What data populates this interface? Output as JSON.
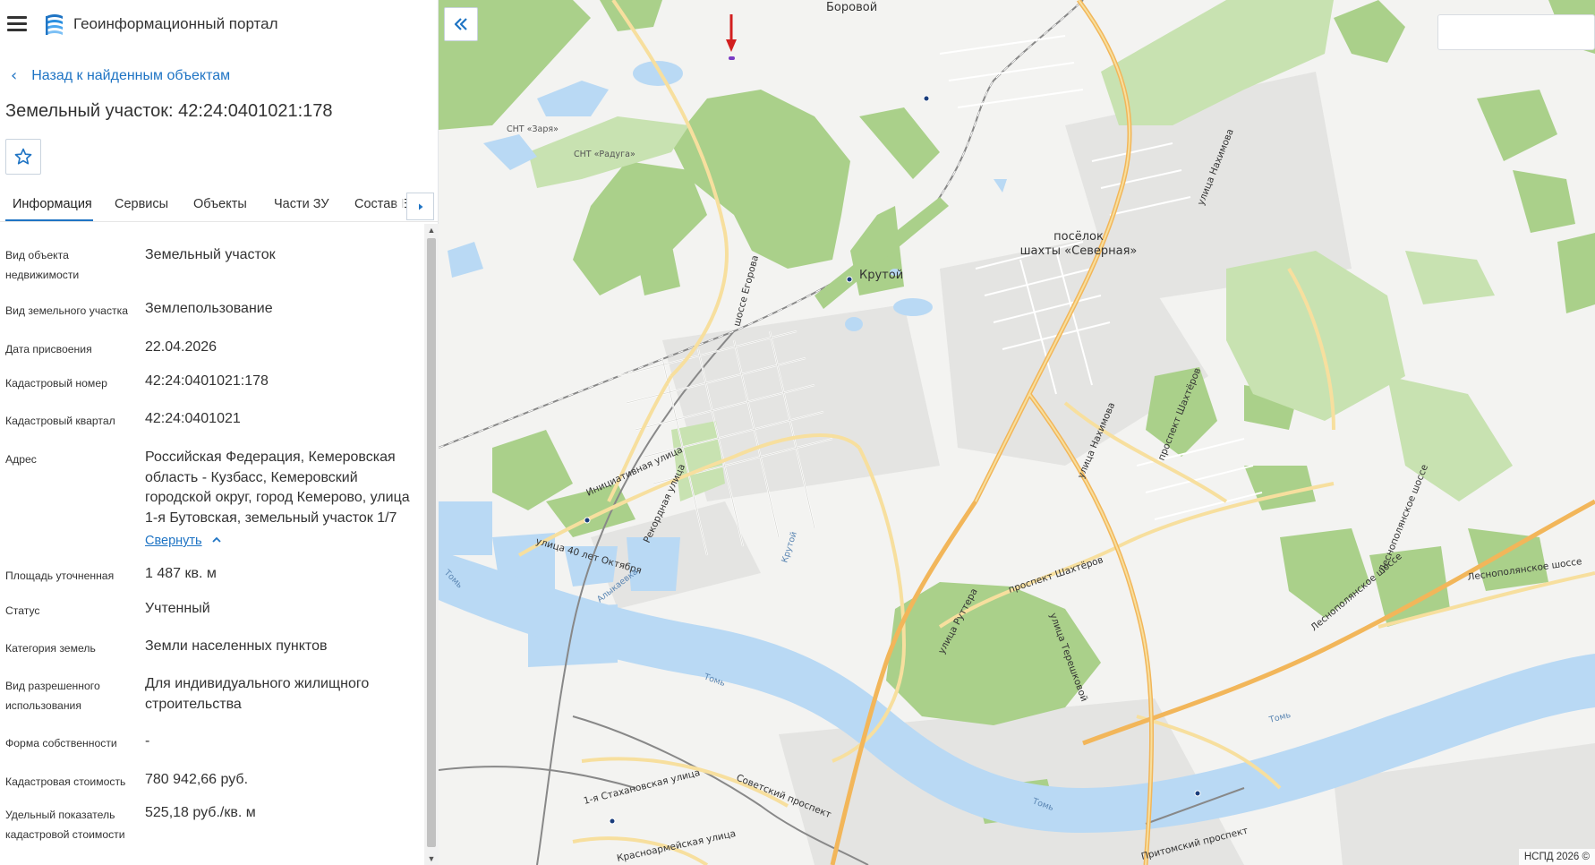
{
  "app": {
    "title": "Геоинформационный портал"
  },
  "nav": {
    "back_label": "Назад к найденным объектам"
  },
  "object": {
    "title": "Земельный участок: 42:24:0401021:178"
  },
  "tabs": [
    {
      "label": "Информация",
      "active": true
    },
    {
      "label": "Сервисы",
      "active": false
    },
    {
      "label": "Объекты",
      "active": false
    },
    {
      "label": "Части ЗУ",
      "active": false
    },
    {
      "label": "Состав ЕЗП",
      "active": false
    }
  ],
  "properties": [
    {
      "label": "Вид объекта недвижимости",
      "value": "Земельный участок"
    },
    {
      "label": "Вид земельного участка",
      "value": "Землепользование"
    },
    {
      "label": "Дата присвоения",
      "value": "22.04.2026"
    },
    {
      "label": "Кадастровый номер",
      "value": "42:24:0401021:178"
    },
    {
      "label": "Кадастровый квартал",
      "value": "42:24:0401021"
    },
    {
      "label": "Адрес",
      "value": "Российская Федерация, Кемеровская область - Кузбасс, Кемеровский городской округ, город Кемерово, улица 1-я Бутовская, земельный участок 1/7"
    },
    {
      "label": "Площадь уточненная",
      "value": "1 487 кв. м"
    },
    {
      "label": "Статус",
      "value": "Учтенный"
    },
    {
      "label": "Категория земель",
      "value": "Земли населенных пунктов"
    },
    {
      "label": "Вид разрешенного использования",
      "value": "Для индивидуального жилищного строительства"
    },
    {
      "label": "Форма собственности",
      "value": "-"
    },
    {
      "label": "Кадастровая стоимость",
      "value": "780 942,66 руб."
    },
    {
      "label": "Удельный показатель кадастровой стоимости",
      "value": "525,18 руб./кв. м"
    }
  ],
  "address_collapse_label": "Свернуть",
  "map": {
    "attribution": "НСПД 2026 ©",
    "labels": {
      "borovoy": "Боровой",
      "krutoy": "Крутой",
      "snt_zarya": "СНТ «Заря»",
      "snt_raduga": "СНТ «Радуга»",
      "poselok_line1": "посёлок",
      "poselok_line2": "шахты «Северная»",
      "shosse_egorova": "шоссе Егорова",
      "ul_nakhimova_top": "улица Нахимова",
      "ul_nakhimova_mid": "улица Нахимова",
      "pr_shakhterov_n": "проспект Шахтёров",
      "pr_shakhterov_s": "проспект Шахтёров",
      "ul_initsiativnaya": "Инициативная улица",
      "ul_rekordnaya": "Рекордная улица",
      "ul_40let": "улица 40 лет Октября",
      "ul_ruttera": "улица Руттера",
      "ul_tereshkovoy": "улица Терешковой",
      "lesnopolyanskoe_1": "Леснополянское шоссе",
      "lesnopolyanskoe_2": "Леснополянское шоссе",
      "lesnopolyanskoe_3": "Леснополянское шоссе",
      "ul_stakhanovskaya": "1-я Стахановская улица",
      "sovetsky_pr": "Советский проспект",
      "krasnoarmeyskaya": "Красноармейская улица",
      "pritomsky_pr": "Притомский проспект",
      "tom_1": "Томь",
      "tom_2": "Томь",
      "tom_3": "Томь",
      "tom_4": "Томь",
      "krutoy_stream": "Крутой",
      "alykaevka": "Алыкаевка"
    },
    "colors": {
      "land": "#f3f3f1",
      "forest": "#aad08a",
      "forest_light": "#c8e2b1",
      "water": "#b9d9f4",
      "major_road": "#f2b65a",
      "road": "#f7df9e",
      "rail": "#888888",
      "marker": "#d21f1f",
      "accent": "#1f74c4"
    }
  }
}
